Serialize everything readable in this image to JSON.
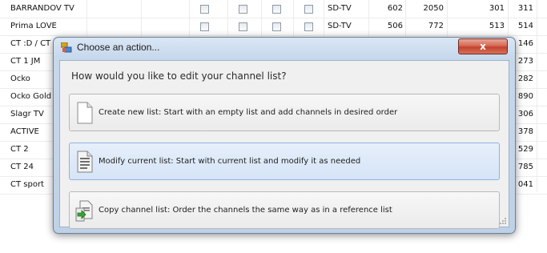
{
  "channel_table": {
    "rows": [
      {
        "name": "BARRANDOV TV",
        "type": "SD-TV",
        "n1": "602",
        "n2": "2050",
        "n3": "301",
        "n4": "311"
      },
      {
        "name": "Prima LOVE",
        "type": "SD-TV",
        "n1": "506",
        "n2": "772",
        "n3": "513",
        "n4": "514"
      },
      {
        "name": "CT :D / CT",
        "type": "",
        "n1": "",
        "n2": "",
        "n3": "",
        "n4": "146"
      },
      {
        "name": "CT 1 JM",
        "type": "",
        "n1": "",
        "n2": "",
        "n3": "",
        "n4": "273"
      },
      {
        "name": "Ocko",
        "type": "",
        "n1": "",
        "n2": "",
        "n3": "",
        "n4": "282"
      },
      {
        "name": "Ocko Gold",
        "type": "",
        "n1": "",
        "n2": "",
        "n3": "",
        "n4": "890"
      },
      {
        "name": "Slagr TV",
        "type": "",
        "n1": "",
        "n2": "",
        "n3": "",
        "n4": "306"
      },
      {
        "name": "ACTIVE",
        "type": "",
        "n1": "",
        "n2": "",
        "n3": "",
        "n4": "378"
      },
      {
        "name": "CT 2",
        "type": "",
        "n1": "",
        "n2": "",
        "n3": "",
        "n4": "529"
      },
      {
        "name": "CT 24",
        "type": "",
        "n1": "",
        "n2": "",
        "n3": "",
        "n4": "785"
      },
      {
        "name": "CT sport",
        "type": "",
        "n1": "",
        "n2": "",
        "n3": "",
        "n4": "041"
      }
    ]
  },
  "dialog": {
    "title": "Choose an action...",
    "close_glyph": "x",
    "question": "How would you like to edit your channel list?",
    "options": [
      {
        "label": "Create new list: Start with an empty list and add channels in desired order",
        "icon": "blank-page-icon"
      },
      {
        "label": "Modify current list: Start with current list and modify it as needed",
        "icon": "document-lines-icon"
      },
      {
        "label": "Copy channel list: Order the channels the same way as in a reference list",
        "icon": "copy-list-icon"
      }
    ]
  },
  "colors": {
    "titlebar": "#c7d8ec",
    "close_button": "#c2432c",
    "hover_option": "#d6e4f7"
  }
}
